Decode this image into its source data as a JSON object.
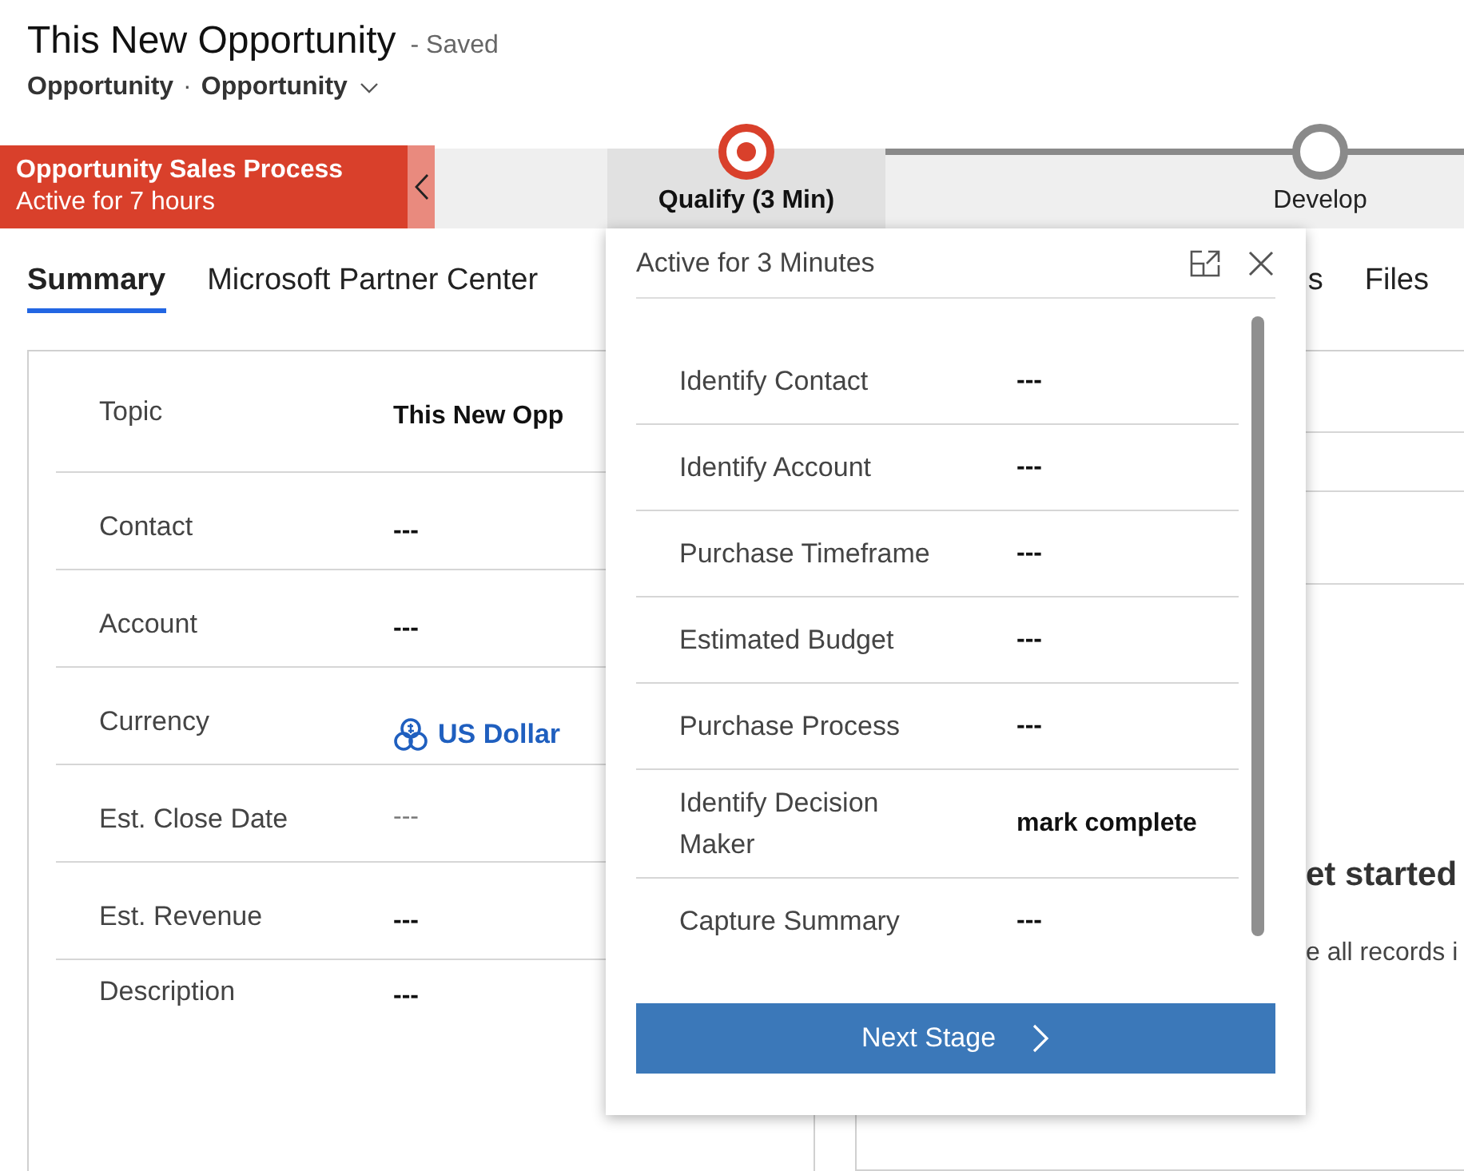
{
  "header": {
    "title": "This New Opportunity",
    "status": "- Saved",
    "entity": "Opportunity",
    "separator": "·",
    "form": "Opportunity"
  },
  "process": {
    "name": "Opportunity Sales Process",
    "duration": "Active for 7 hours",
    "stages": [
      {
        "label": "Qualify  (3 Min)",
        "selected": true
      },
      {
        "label": "Develop",
        "selected": false
      }
    ]
  },
  "tabs": [
    {
      "label": "Summary",
      "selected": true
    },
    {
      "label": "Microsoft Partner Center",
      "selected": false
    },
    {
      "label": "s",
      "selected": false
    },
    {
      "label": "Files",
      "selected": false
    }
  ],
  "summary": {
    "fields": [
      {
        "label": "Topic",
        "value": "This New Opp",
        "kind": "text"
      },
      {
        "label": "Contact",
        "value": "---",
        "kind": "text"
      },
      {
        "label": "Account",
        "value": "---",
        "kind": "text"
      },
      {
        "label": "Currency",
        "value": "US Dollar",
        "kind": "lookup"
      },
      {
        "label": "Est. Close Date",
        "value": "---",
        "kind": "date"
      },
      {
        "label": "Est. Revenue",
        "value": "---",
        "kind": "text"
      },
      {
        "label": "Description",
        "value": "---",
        "kind": "text"
      }
    ]
  },
  "timeline": {
    "heading": "et started",
    "text": "e all records i"
  },
  "stage_flyout": {
    "title": "Active for 3 Minutes",
    "fields": [
      {
        "label": "Identify Contact",
        "value": "---"
      },
      {
        "label": "Identify Account",
        "value": "---"
      },
      {
        "label": "Purchase Timeframe",
        "value": "---"
      },
      {
        "label": "Estimated Budget",
        "value": "---"
      },
      {
        "label": "Purchase Process",
        "value": "---"
      },
      {
        "label": "Identify Decision Maker",
        "value": "mark complete"
      },
      {
        "label": "Capture Summary",
        "value": "---"
      }
    ],
    "next_button": "Next Stage"
  }
}
